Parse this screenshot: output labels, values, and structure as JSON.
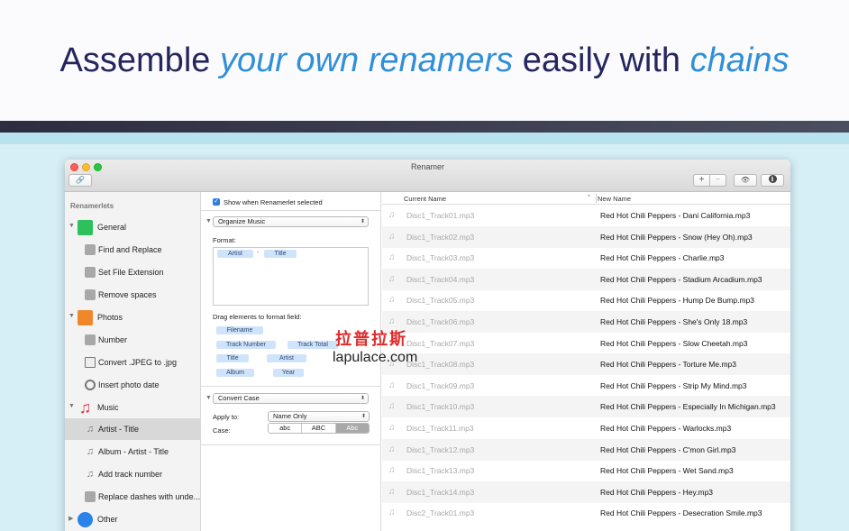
{
  "headline": {
    "part1": "Assemble ",
    "part2": "your own renamers",
    "part3": " easily with ",
    "part4": "chains"
  },
  "window": {
    "title": "Renamer",
    "toolbar": {
      "link_icon": "🔗",
      "plus_label": "+",
      "minus_label": "−",
      "eye_icon": "👁",
      "info_icon": "i"
    }
  },
  "sidebar": {
    "header": "Renamerlets",
    "groups": [
      {
        "label": "General",
        "icon": "cube-icon",
        "children": [
          "Find and Replace",
          "Set File Extension",
          "Remove spaces"
        ]
      },
      {
        "label": "Photos",
        "icon": "photos-icon",
        "children": [
          "Number",
          "Convert .JPEG to .jpg",
          "Insert photo date"
        ]
      },
      {
        "label": "Music",
        "icon": "music-note-icon",
        "children": [
          "Artist - Title",
          "Album - Artist - Title",
          "Add track number",
          "Replace dashes with unde..."
        ]
      },
      {
        "label": "Other",
        "icon": "gear-icon",
        "children": []
      }
    ],
    "selected": "Artist - Title"
  },
  "middle": {
    "checkbox_label": "Show when Renamerlet selected",
    "organize": {
      "popup_value": "Organize Music",
      "format_label": "Format:",
      "format_tokens": [
        "Artist",
        "-",
        "Title"
      ],
      "drag_label": "Drag elements to format field:",
      "elements": [
        "Filename",
        "Track Number",
        "Track Total",
        "Title",
        "Artist",
        "Album",
        "Year"
      ]
    },
    "convert": {
      "popup_value": "Convert Case",
      "apply_label": "Apply to:",
      "apply_value": "Name Only",
      "case_label": "Case:",
      "case_options": [
        "abc",
        "ABC",
        "Abc"
      ]
    }
  },
  "table": {
    "col_current": "Current Name",
    "col_new": "New Name",
    "rows": [
      {
        "current": "Disc1_Track01.mp3",
        "new": "Red Hot Chili Peppers - Dani California.mp3"
      },
      {
        "current": "Disc1_Track02.mp3",
        "new": "Red Hot Chili Peppers - Snow (Hey Oh).mp3"
      },
      {
        "current": "Disc1_Track03.mp3",
        "new": "Red Hot Chili Peppers - Charlie.mp3"
      },
      {
        "current": "Disc1_Track04.mp3",
        "new": "Red Hot Chili Peppers - Stadium Arcadium.mp3"
      },
      {
        "current": "Disc1_Track05.mp3",
        "new": "Red Hot Chili Peppers - Hump De Bump.mp3"
      },
      {
        "current": "Disc1_Track06.mp3",
        "new": "Red Hot Chili Peppers - She's Only 18.mp3"
      },
      {
        "current": "Disc1_Track07.mp3",
        "new": "Red Hot Chili Peppers - Slow Cheetah.mp3"
      },
      {
        "current": "Disc1_Track08.mp3",
        "new": "Red Hot Chili Peppers - Torture Me.mp3"
      },
      {
        "current": "Disc1_Track09.mp3",
        "new": "Red Hot Chili Peppers - Strip My Mind.mp3"
      },
      {
        "current": "Disc1_Track10.mp3",
        "new": "Red Hot Chili Peppers - Especially In Michigan.mp3"
      },
      {
        "current": "Disc1_Track11.mp3",
        "new": "Red Hot Chili Peppers - Warlocks.mp3"
      },
      {
        "current": "Disc1_Track12.mp3",
        "new": "Red Hot Chili Peppers - C'mon Girl.mp3"
      },
      {
        "current": "Disc1_Track13.mp3",
        "new": "Red Hot Chili Peppers - Wet Sand.mp3"
      },
      {
        "current": "Disc1_Track14.mp3",
        "new": "Red Hot Chili Peppers - Hey.mp3"
      },
      {
        "current": "Disc2_Track01.mp3",
        "new": "Red Hot Chili Peppers - Desecration Smile.mp3"
      }
    ]
  },
  "watermark": {
    "cn": "拉普拉斯",
    "en": "lapulace.com"
  },
  "colors": {
    "accent": "#2f8fd8",
    "headline_text": "#26265e",
    "band": "#b9e2ef",
    "background_below": "#d6eef6"
  }
}
